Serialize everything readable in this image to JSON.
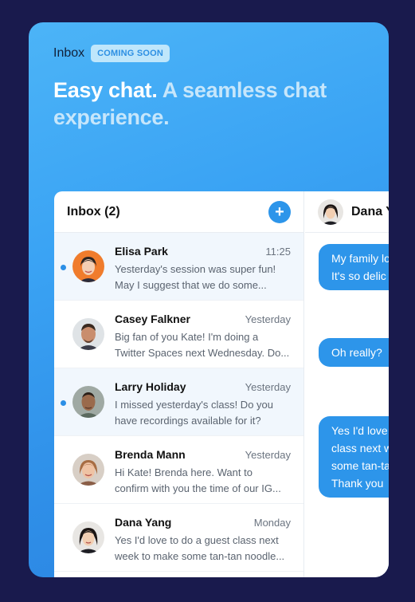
{
  "header": {
    "title": "Inbox",
    "badge": "COMING SOON"
  },
  "headline": {
    "part1": "Easy chat.",
    "part2": "A seamless chat experience."
  },
  "inbox": {
    "title": "Inbox (2)",
    "add_icon": "plus-icon",
    "conversations": [
      {
        "name": "Elisa Park",
        "time": "11:25",
        "line1": "Yesterday's session was super fun!",
        "line2": "May I suggest that we do some...",
        "unread": true
      },
      {
        "name": "Casey Falkner",
        "time": "Yesterday",
        "line1": "Big fan of you Kate! I'm doing a",
        "line2": "Twitter Spaces next Wednesday. Do...",
        "unread": false
      },
      {
        "name": "Larry Holiday",
        "time": "Yesterday",
        "line1": "I missed yesterday's class! Do you",
        "line2": "have recordings available for it?",
        "unread": true
      },
      {
        "name": "Brenda Mann",
        "time": "Yesterday",
        "line1": "Hi Kate! Brenda here. Want to",
        "line2": "confirm with you the time of our IG...",
        "unread": false
      },
      {
        "name": "Dana Yang",
        "time": "Monday",
        "line1": "Yes I'd love to do a guest class next",
        "line2": "week to make some tan-tan noodle...",
        "unread": false
      }
    ]
  },
  "chat": {
    "contact": "Dana Yang",
    "messages": [
      {
        "line1": "My family lo",
        "line2": "It's so delic"
      },
      {
        "line1": "Oh really?"
      },
      {
        "line1": "Yes I'd love",
        "line2": "class next w",
        "line3": "some tan-ta",
        "line4": "Thank you"
      }
    ]
  },
  "colors": {
    "background": "#191a4d",
    "accent": "#2d95ea",
    "badge_bg": "#bfe6fb"
  }
}
